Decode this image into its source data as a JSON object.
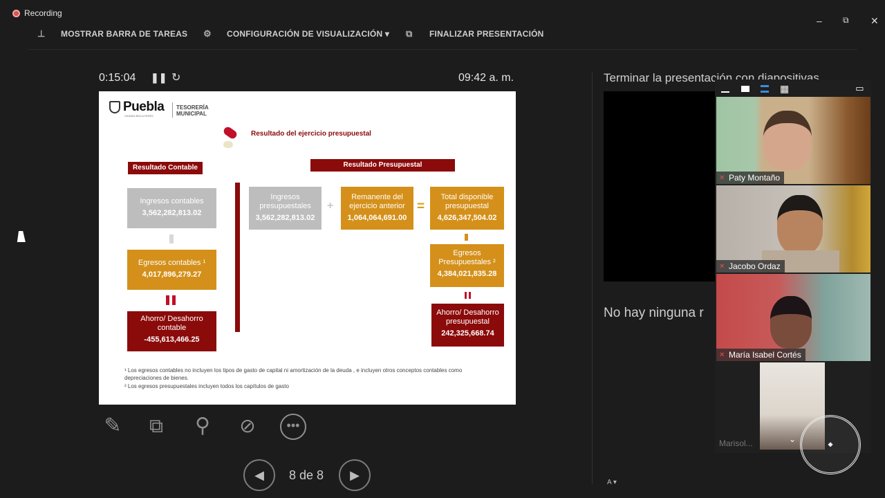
{
  "recording": {
    "label": "Recording"
  },
  "window_controls": {
    "minimize": "–",
    "restore": "⧉",
    "close": "✕"
  },
  "toolbar": {
    "show_taskbar": "MOSTRAR BARRA DE TAREAS",
    "display_settings": "CONFIGURACIÓN DE VISUALIZACIÓN ▾",
    "end_presentation": "FINALIZAR PRESENTACIÓN"
  },
  "presenter": {
    "elapsed": "0:15:04",
    "clock": "09:42 a. m.",
    "slide_counter": "8 de 8"
  },
  "slide": {
    "logo_name": "Puebla",
    "logo_sub": "CIUDAD INCLUYENTE",
    "logo_dept_1": "TESORERÍA",
    "logo_dept_2": "MUNICIPAL",
    "title": "Resultado del ejercicio presupuestal",
    "contable": {
      "header": "Resultado Contable",
      "ingresos_label": "Ingresos contables",
      "ingresos_value": "3,562,282,813.02",
      "egresos_label": "Egresos contables ¹",
      "egresos_value": "4,017,896,279.27",
      "ahorro_label": "Ahorro/ Desahorro contable",
      "ahorro_value": "-455,613,466.25"
    },
    "presupuestal": {
      "header": "Resultado Presupuestal",
      "ingresos_label": "Ingresos presupuestales",
      "ingresos_value": "3,562,282,813.02",
      "remanente_label": "Remanente del ejercicio anterior",
      "remanente_value": "1,064,064,691.00",
      "total_label": "Total disponible presupuestal",
      "total_value": "4,626,347,504.02",
      "egresos_label": "Egresos Presupuestales ²",
      "egresos_value": "4,384,021,835.28",
      "ahorro_label": "Ahorro/ Desahorro presupuestal",
      "ahorro_value": "242,325,668.74"
    },
    "footnote_1": "¹ Los egresos contables no incluyen los tipos de gasto de capital ni amortización de la deuda , e incluyen otros conceptos contables como depreciaciones de bienes.",
    "footnote_2": "² Los egresos presupuestales incluyen todos los capítulos de gasto"
  },
  "right_panel": {
    "title": "Terminar la presentación con diapositivas",
    "empty_notes": "No hay ninguna r"
  },
  "participants": [
    {
      "name": "Paty Montaño"
    },
    {
      "name": "Jacobo Ordaz"
    },
    {
      "name": "María Isabel Cortés"
    },
    {
      "name": "Marisol..."
    }
  ],
  "colors": {
    "background": "#1c1c1c",
    "slide_red": "#8b0a0a",
    "slide_orange": "#d4901a",
    "slide_grey": "#bdbdbd",
    "record_red": "#d9534f"
  },
  "icons": {
    "pen": "pen-icon",
    "all_slides": "slides-grid-icon",
    "zoom": "magnifier-icon",
    "black_screen": "black-screen-icon",
    "more": "more-options-icon",
    "prev": "previous-slide-icon",
    "next": "next-slide-icon"
  }
}
